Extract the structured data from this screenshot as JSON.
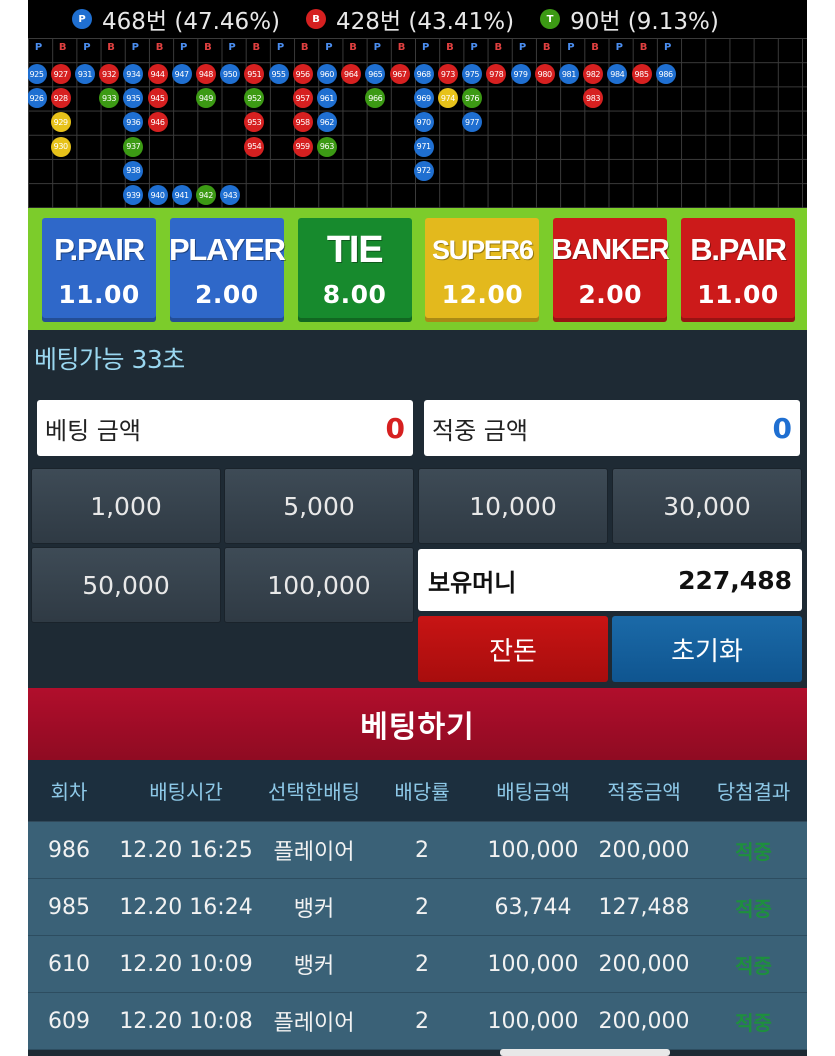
{
  "stats": [
    {
      "badge": "P",
      "color": "#1f6fd1",
      "text": "468번 (47.46%)"
    },
    {
      "badge": "B",
      "color": "#d62020",
      "text": "428번 (43.41%)"
    },
    {
      "badge": "T",
      "color": "#3c9a14",
      "text": "90번 (9.13%)"
    }
  ],
  "road": {
    "headers": [
      "P",
      "B",
      "P",
      "B",
      "P",
      "B",
      "P",
      "B",
      "P",
      "B",
      "P",
      "B",
      "P",
      "B",
      "P",
      "B",
      "P",
      "B",
      "P",
      "B",
      "P",
      "B",
      "P",
      "B",
      "P",
      "B",
      "P"
    ],
    "beads": [
      {
        "col": 0,
        "row": 0,
        "n": "925",
        "c": "#1f6fd1"
      },
      {
        "col": 0,
        "row": 1,
        "n": "926",
        "c": "#1f6fd1"
      },
      {
        "col": 1,
        "row": 0,
        "n": "927",
        "c": "#d62020"
      },
      {
        "col": 1,
        "row": 1,
        "n": "928",
        "c": "#d62020"
      },
      {
        "col": 1,
        "row": 2,
        "n": "929",
        "c": "#e7c21a"
      },
      {
        "col": 1,
        "row": 3,
        "n": "930",
        "c": "#e7c21a"
      },
      {
        "col": 2,
        "row": 0,
        "n": "931",
        "c": "#1f6fd1"
      },
      {
        "col": 3,
        "row": 0,
        "n": "932",
        "c": "#d62020"
      },
      {
        "col": 3,
        "row": 1,
        "n": "933",
        "c": "#3c9a14"
      },
      {
        "col": 4,
        "row": 0,
        "n": "934",
        "c": "#1f6fd1"
      },
      {
        "col": 4,
        "row": 1,
        "n": "935",
        "c": "#1f6fd1"
      },
      {
        "col": 4,
        "row": 2,
        "n": "936",
        "c": "#1f6fd1"
      },
      {
        "col": 4,
        "row": 3,
        "n": "937",
        "c": "#3c9a14"
      },
      {
        "col": 4,
        "row": 4,
        "n": "938",
        "c": "#1f6fd1"
      },
      {
        "col": 4,
        "row": 5,
        "n": "939",
        "c": "#1f6fd1"
      },
      {
        "col": 5,
        "row": 5,
        "n": "940",
        "c": "#1f6fd1"
      },
      {
        "col": 6,
        "row": 5,
        "n": "941",
        "c": "#1f6fd1"
      },
      {
        "col": 7,
        "row": 5,
        "n": "942",
        "c": "#3c9a14"
      },
      {
        "col": 8,
        "row": 5,
        "n": "943",
        "c": "#1f6fd1"
      },
      {
        "col": 5,
        "row": 0,
        "n": "944",
        "c": "#d62020"
      },
      {
        "col": 5,
        "row": 1,
        "n": "945",
        "c": "#d62020"
      },
      {
        "col": 5,
        "row": 2,
        "n": "946",
        "c": "#d62020"
      },
      {
        "col": 6,
        "row": 0,
        "n": "947",
        "c": "#1f6fd1"
      },
      {
        "col": 7,
        "row": 0,
        "n": "948",
        "c": "#d62020"
      },
      {
        "col": 7,
        "row": 1,
        "n": "949",
        "c": "#3c9a14"
      },
      {
        "col": 8,
        "row": 0,
        "n": "950",
        "c": "#1f6fd1"
      },
      {
        "col": 9,
        "row": 0,
        "n": "951",
        "c": "#d62020"
      },
      {
        "col": 9,
        "row": 1,
        "n": "952",
        "c": "#3c9a14"
      },
      {
        "col": 9,
        "row": 2,
        "n": "953",
        "c": "#d62020"
      },
      {
        "col": 9,
        "row": 3,
        "n": "954",
        "c": "#d62020"
      },
      {
        "col": 10,
        "row": 0,
        "n": "955",
        "c": "#1f6fd1"
      },
      {
        "col": 11,
        "row": 0,
        "n": "956",
        "c": "#d62020"
      },
      {
        "col": 11,
        "row": 1,
        "n": "957",
        "c": "#d62020"
      },
      {
        "col": 11,
        "row": 2,
        "n": "958",
        "c": "#d62020"
      },
      {
        "col": 11,
        "row": 3,
        "n": "959",
        "c": "#d62020"
      },
      {
        "col": 12,
        "row": 0,
        "n": "960",
        "c": "#1f6fd1"
      },
      {
        "col": 12,
        "row": 1,
        "n": "961",
        "c": "#1f6fd1"
      },
      {
        "col": 12,
        "row": 2,
        "n": "962",
        "c": "#1f6fd1"
      },
      {
        "col": 12,
        "row": 3,
        "n": "963",
        "c": "#3c9a14"
      },
      {
        "col": 13,
        "row": 0,
        "n": "964",
        "c": "#d62020"
      },
      {
        "col": 14,
        "row": 0,
        "n": "965",
        "c": "#1f6fd1"
      },
      {
        "col": 14,
        "row": 1,
        "n": "966",
        "c": "#3c9a14"
      },
      {
        "col": 15,
        "row": 0,
        "n": "967",
        "c": "#d62020"
      },
      {
        "col": 16,
        "row": 0,
        "n": "968",
        "c": "#1f6fd1"
      },
      {
        "col": 16,
        "row": 1,
        "n": "969",
        "c": "#1f6fd1"
      },
      {
        "col": 16,
        "row": 2,
        "n": "970",
        "c": "#1f6fd1"
      },
      {
        "col": 16,
        "row": 3,
        "n": "971",
        "c": "#1f6fd1"
      },
      {
        "col": 16,
        "row": 4,
        "n": "972",
        "c": "#1f6fd1"
      },
      {
        "col": 17,
        "row": 0,
        "n": "973",
        "c": "#d62020"
      },
      {
        "col": 17,
        "row": 1,
        "n": "974",
        "c": "#e7c21a"
      },
      {
        "col": 18,
        "row": 0,
        "n": "975",
        "c": "#1f6fd1"
      },
      {
        "col": 18,
        "row": 1,
        "n": "976",
        "c": "#3c9a14"
      },
      {
        "col": 18,
        "row": 2,
        "n": "977",
        "c": "#1f6fd1"
      },
      {
        "col": 19,
        "row": 0,
        "n": "978",
        "c": "#d62020"
      },
      {
        "col": 20,
        "row": 0,
        "n": "979",
        "c": "#1f6fd1"
      },
      {
        "col": 21,
        "row": 0,
        "n": "980",
        "c": "#d62020"
      },
      {
        "col": 22,
        "row": 0,
        "n": "981",
        "c": "#1f6fd1"
      },
      {
        "col": 23,
        "row": 0,
        "n": "982",
        "c": "#d62020"
      },
      {
        "col": 23,
        "row": 1,
        "n": "983",
        "c": "#d62020"
      },
      {
        "col": 24,
        "row": 0,
        "n": "984",
        "c": "#1f6fd1"
      },
      {
        "col": 25,
        "row": 0,
        "n": "985",
        "c": "#d62020"
      },
      {
        "col": 26,
        "row": 0,
        "n": "986",
        "c": "#1f6fd1"
      }
    ]
  },
  "bets": [
    {
      "name": "P.PAIR",
      "odds": "11.00",
      "color": "#2f68c9"
    },
    {
      "name": "PLAYER",
      "odds": "2.00",
      "color": "#2f68c9"
    },
    {
      "name": "TIE",
      "odds": "8.00",
      "color": "#178a2d"
    },
    {
      "name": "SUPER6",
      "odds": "12.00",
      "color": "#e3b91d"
    },
    {
      "name": "BANKER",
      "odds": "2.00",
      "color": "#cc1a1a"
    },
    {
      "name": "B.PAIR",
      "odds": "11.00",
      "color": "#cc1a1a"
    }
  ],
  "timer": "베팅가능 33초",
  "bet_amount": {
    "label": "베팅 금액",
    "value": "0",
    "color": "#d62020"
  },
  "win_amount": {
    "label": "적중 금액",
    "value": "0",
    "color": "#1f6fd1"
  },
  "chips": [
    "1,000",
    "5,000",
    "10,000",
    "30,000",
    "50,000",
    "100,000"
  ],
  "money": {
    "label": "보유머니",
    "value": "227,488"
  },
  "buttons": {
    "change": "잔돈",
    "reset": "초기화",
    "place": "베팅하기"
  },
  "history": {
    "headers": [
      "회차",
      "배팅시간",
      "선택한배팅",
      "배당률",
      "배팅금액",
      "적중금액",
      "당첨결과"
    ],
    "rows": [
      [
        "986",
        "12.20 16:25",
        "플레이어",
        "2",
        "100,000",
        "200,000",
        "적중"
      ],
      [
        "985",
        "12.20 16:24",
        "뱅커",
        "2",
        "63,744",
        "127,488",
        "적중"
      ],
      [
        "610",
        "12.20 10:09",
        "뱅커",
        "2",
        "100,000",
        "200,000",
        "적중"
      ],
      [
        "609",
        "12.20 10:08",
        "플레이어",
        "2",
        "100,000",
        "200,000",
        "적중"
      ]
    ]
  }
}
